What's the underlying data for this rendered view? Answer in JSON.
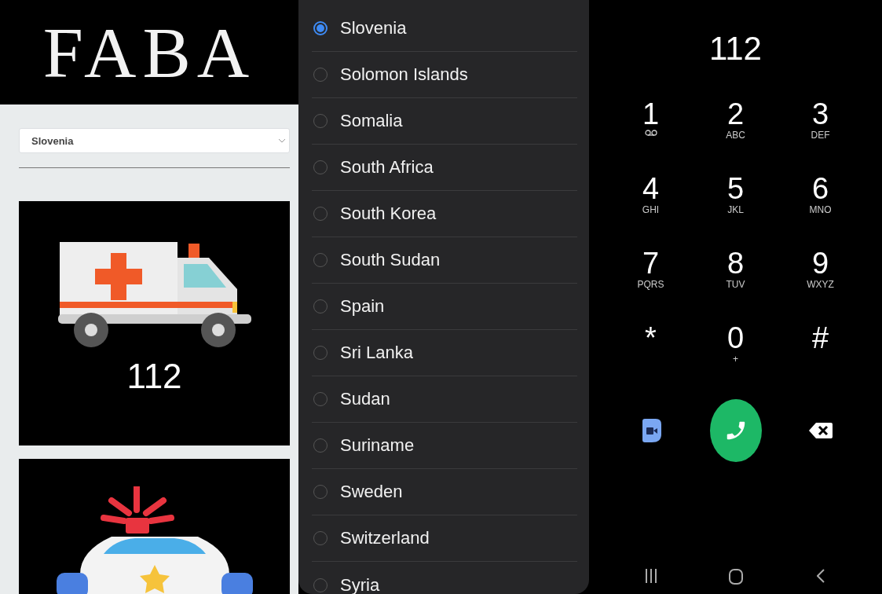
{
  "site": {
    "logo": "FABA",
    "country_select": {
      "value": "Slovenia"
    },
    "cards": [
      {
        "kind": "ambulance",
        "number": "112"
      },
      {
        "kind": "police"
      }
    ]
  },
  "country_dialog": {
    "options": [
      {
        "label": "Slovenia",
        "selected": true
      },
      {
        "label": "Solomon Islands",
        "selected": false
      },
      {
        "label": "Somalia",
        "selected": false
      },
      {
        "label": "South Africa",
        "selected": false
      },
      {
        "label": "South Korea",
        "selected": false
      },
      {
        "label": "South Sudan",
        "selected": false
      },
      {
        "label": "Spain",
        "selected": false
      },
      {
        "label": "Sri Lanka",
        "selected": false
      },
      {
        "label": "Sudan",
        "selected": false
      },
      {
        "label": "Suriname",
        "selected": false
      },
      {
        "label": "Sweden",
        "selected": false
      },
      {
        "label": "Switzerland",
        "selected": false
      },
      {
        "label": "Syria",
        "selected": false
      }
    ]
  },
  "dialer": {
    "number": "112",
    "keys": [
      {
        "digit": "1",
        "kind": "voicemail"
      },
      {
        "digit": "2",
        "kind": "letters",
        "letters": "ABC"
      },
      {
        "digit": "3",
        "kind": "letters",
        "letters": "DEF"
      },
      {
        "digit": "4",
        "kind": "letters",
        "letters": "GHI"
      },
      {
        "digit": "5",
        "kind": "letters",
        "letters": "JKL"
      },
      {
        "digit": "6",
        "kind": "letters",
        "letters": "MNO"
      },
      {
        "digit": "7",
        "kind": "letters",
        "letters": "PQRS"
      },
      {
        "digit": "8",
        "kind": "letters",
        "letters": "TUV"
      },
      {
        "digit": "9",
        "kind": "letters",
        "letters": "WXYZ"
      },
      {
        "digit": "*",
        "kind": "plain"
      },
      {
        "digit": "0",
        "kind": "letters",
        "letters": "+"
      },
      {
        "digit": "#",
        "kind": "plain"
      }
    ]
  }
}
